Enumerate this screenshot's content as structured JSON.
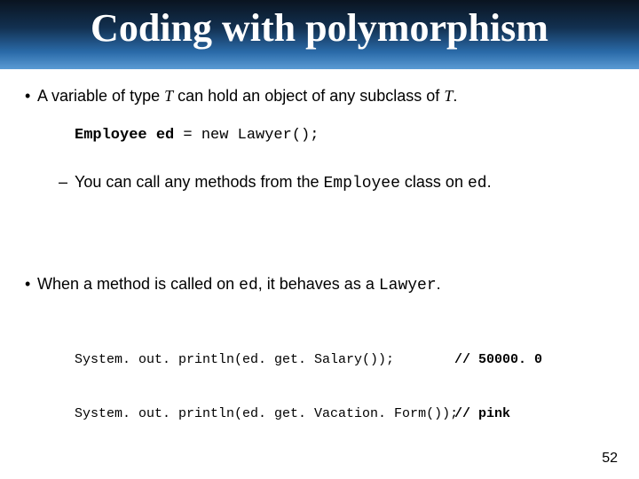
{
  "title": "Coding with polymorphism",
  "bullet1_pre": "A variable of type ",
  "bullet1_T1": "T",
  "bullet1_mid": " can hold an object of any subclass of ",
  "bullet1_T2": "T",
  "bullet1_post": ".",
  "code1_bold": "Employee ed",
  "code1_rest": " = new Lawyer();",
  "sub_pre": "You can call any methods from the ",
  "sub_emp": "Employee",
  "sub_mid": " class on ",
  "sub_ed": "ed",
  "sub_post": ".",
  "bullet2_pre": "When a method is called on ",
  "bullet2_ed": "ed",
  "bullet2_mid": ", it behaves as a ",
  "bullet2_law": "Lawyer",
  "bullet2_post": ".",
  "code2_line1_left": "System. out. println(ed. get. Salary());",
  "code2_line1_comment": "// 50000. 0",
  "code2_line2_left": "System. out. println(ed. get. Vacation. Form());",
  "code2_line2_comment": "// pink",
  "page_number": "52",
  "chart_data": null
}
